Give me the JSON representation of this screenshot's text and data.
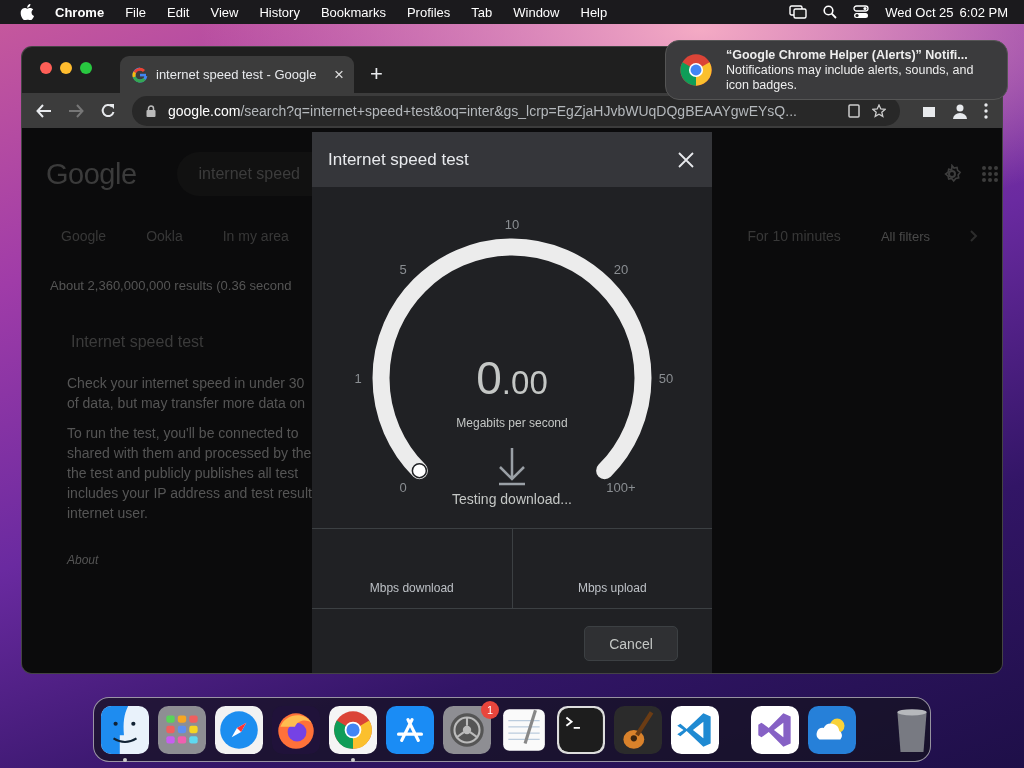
{
  "menu_bar": {
    "app": "Chrome",
    "menus": [
      "File",
      "Edit",
      "View",
      "History",
      "Bookmarks",
      "Profiles",
      "Tab",
      "Window",
      "Help"
    ],
    "date": "Wed Oct 25",
    "time": "6:02 PM"
  },
  "browser": {
    "tab": {
      "title": "internet speed test - Google",
      "close": "×"
    },
    "new_tab": "+",
    "address": {
      "host": "google.com",
      "path": "/search?q=internet+speed+test&oq=inter&gs_lcrp=EgZjaHJvbWUqDQgBEAAYgwEYsQ..."
    }
  },
  "page": {
    "logo": "Google",
    "search_value": "internet speed",
    "chips": [
      "Google",
      "Ookla",
      "In my area"
    ],
    "right_chips": [
      "For 10 minutes",
      "All filters"
    ],
    "result_stats": "About 2,360,000,000 results (0.36 second",
    "card_title": "Internet speed test",
    "paragraphs": [
      [
        "Check your internet speed in under 30",
        "of data, but may transfer more data on"
      ],
      [
        "To run the test, you'll be connected to",
        "shared with them and processed by the",
        "the test and publicly publishes all test",
        "includes your IP address and test result",
        "internet user."
      ]
    ],
    "about": "About"
  },
  "dialog": {
    "title": "Internet speed test",
    "gauge": {
      "ticks": [
        "0",
        "1",
        "5",
        "10",
        "20",
        "50",
        "100+"
      ],
      "value_int": "0",
      "value_frac": ".00",
      "unit": "Megabits per second",
      "status": "Testing download..."
    },
    "stats": [
      "Mbps download",
      "Mbps upload"
    ],
    "cancel": "Cancel"
  },
  "notification": {
    "title": "“Google Chrome Helper (Alerts)” Notifi...",
    "body": "Notifications may include alerts, sounds, and icon badges."
  },
  "dock": {
    "apps": [
      {
        "kind": "finder",
        "running": true
      },
      {
        "kind": "launchpad",
        "running": false
      },
      {
        "kind": "safari",
        "running": false
      },
      {
        "kind": "firefox",
        "running": false
      },
      {
        "kind": "chrome",
        "running": true
      },
      {
        "kind": "appstore",
        "running": false
      },
      {
        "kind": "settings",
        "running": false,
        "badge": "1"
      },
      {
        "kind": "textedit",
        "running": false
      },
      {
        "kind": "terminal",
        "running": false
      },
      {
        "kind": "garageband",
        "running": false
      },
      {
        "kind": "vscode",
        "running": false
      },
      {
        "kind": "separator"
      },
      {
        "kind": "visualstudio",
        "running": false
      },
      {
        "kind": "weather",
        "running": false
      },
      {
        "kind": "separator"
      },
      {
        "kind": "trash",
        "running": false
      }
    ]
  }
}
